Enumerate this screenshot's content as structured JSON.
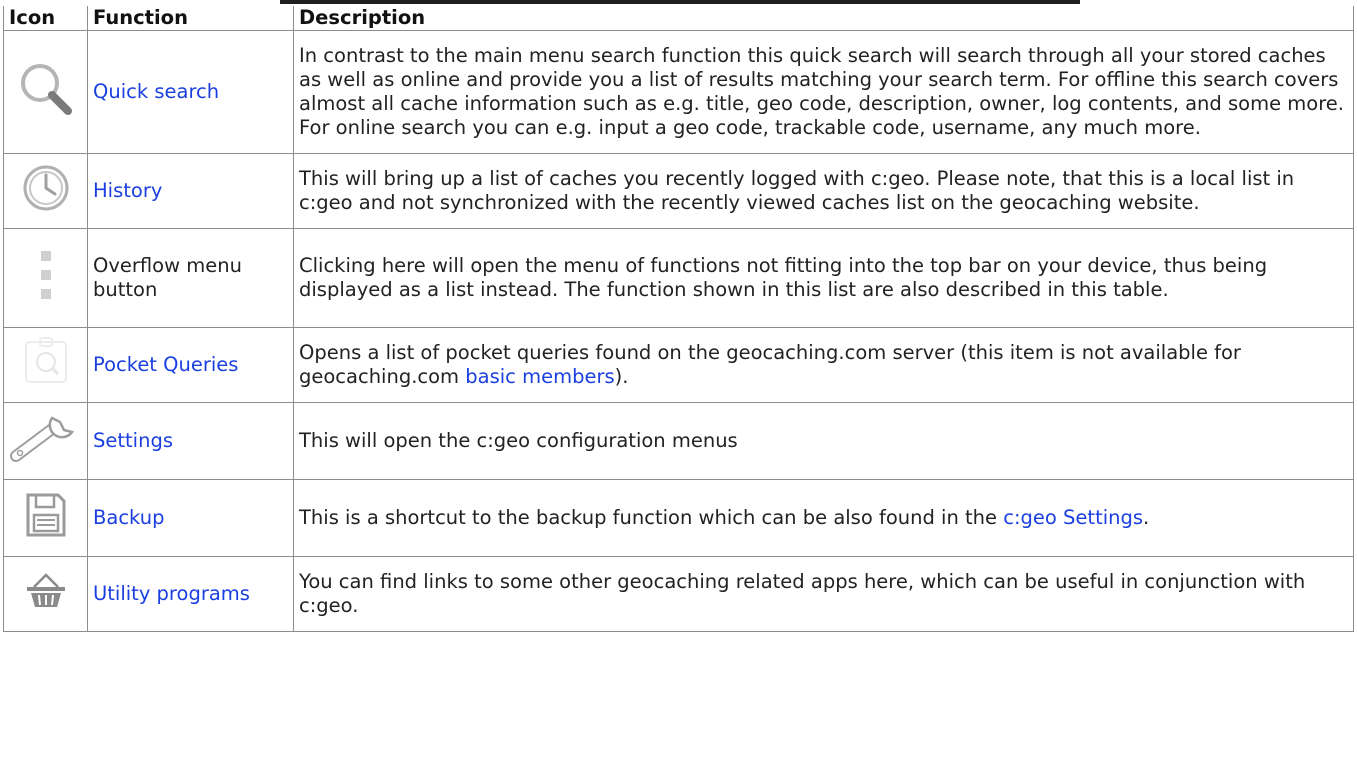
{
  "table": {
    "headers": {
      "icon": "Icon",
      "function": "Function",
      "description": "Description"
    },
    "rows": [
      {
        "icon": "magnifier-icon",
        "function": "Quick search",
        "desc": "In contrast to the main menu search function this quick search will search through all your stored caches as well as online and provide you a list of results matching your search term. For offline this search covers almost all cache information such as e.g. title, geo code, description, owner, log contents, and some more. For online search you can e.g. input a geo code, trackable code, username, any much more."
      },
      {
        "icon": "history-clock-icon",
        "function": "History",
        "desc": "This will bring up a list of caches you recently logged with c:geo. Please note, that this is a local list in c:geo and not synchronized with the recently viewed caches list on the geocaching website."
      },
      {
        "icon": "overflow-menu-icon",
        "function": "Overflow menu button",
        "desc": "Clicking here will open the menu of functions not fitting into the top bar on your device, thus being displayed as a list instead. The function shown in this list are also described in this table."
      },
      {
        "icon": "pocket-query-icon",
        "function": "Pocket Queries",
        "desc_before": "Opens a list of pocket queries found on the geocaching.com server (this item is not available for geocaching.com ",
        "desc_link": "basic members",
        "desc_after": ")."
      },
      {
        "icon": "wrench-icon",
        "function": "Settings",
        "desc": "This will open the c:geo configuration menus"
      },
      {
        "icon": "floppy-disk-icon",
        "function": "Backup",
        "desc_before": "This is a shortcut to the backup function which can be also found in the ",
        "desc_link": "c:geo Settings",
        "desc_after": "."
      },
      {
        "icon": "basket-icon",
        "function": "Utility programs",
        "desc": "You can find links to some other geocaching related apps here, which can be useful in conjunction with c:geo."
      }
    ]
  },
  "colors": {
    "link": "#1a3fe0",
    "border": "#8d8d8d",
    "icon": "#9a9a9a"
  }
}
